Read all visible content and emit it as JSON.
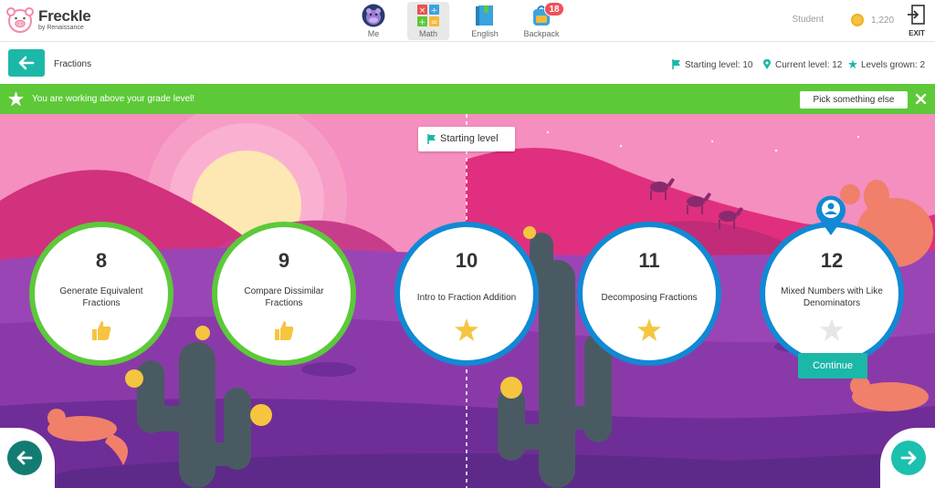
{
  "brand": {
    "name": "Freckle",
    "sub": "by Renaissance"
  },
  "nav": [
    {
      "label": "Me",
      "icon": "hippo-avatar-icon"
    },
    {
      "label": "Math",
      "icon": "math-icon"
    },
    {
      "label": "English",
      "icon": "book-icon"
    },
    {
      "label": "Backpack",
      "icon": "backpack-icon",
      "badge": "18"
    }
  ],
  "user": {
    "name": "Student",
    "coins": "1,220",
    "exit_label": "EXIT"
  },
  "subheader": {
    "breadcrumb": "Fractions",
    "starting_level": "Starting level: 10",
    "current_level": "Current level: 12",
    "levels_grown": "Levels grown: 2"
  },
  "banner": {
    "message": "You are working above your grade level!",
    "pick_label": "Pick something else",
    "color": "#5dc938"
  },
  "scene": {
    "starting_label": "Starting level",
    "continue_label": "Continue"
  },
  "levels": [
    {
      "number": "8",
      "name": "Generate Equivalent Fractions",
      "status": "thumbs-up",
      "ring": "#5cc93a"
    },
    {
      "number": "9",
      "name": "Compare Dissimilar Fractions",
      "status": "thumbs-up",
      "ring": "#5cc93a"
    },
    {
      "number": "10",
      "name": "Intro to Fraction Addition",
      "status": "star",
      "ring": "#1189d4"
    },
    {
      "number": "11",
      "name": "Decomposing Fractions",
      "status": "star",
      "ring": "#1189d4"
    },
    {
      "number": "12",
      "name": "Mixed Numbers with Like Denominators",
      "status": "empty-star",
      "ring": "#1189d4",
      "current": true
    }
  ],
  "colors": {
    "accent": "#1bb8a7",
    "sky": "#f48fbf",
    "ground": "#8a3aa8"
  }
}
